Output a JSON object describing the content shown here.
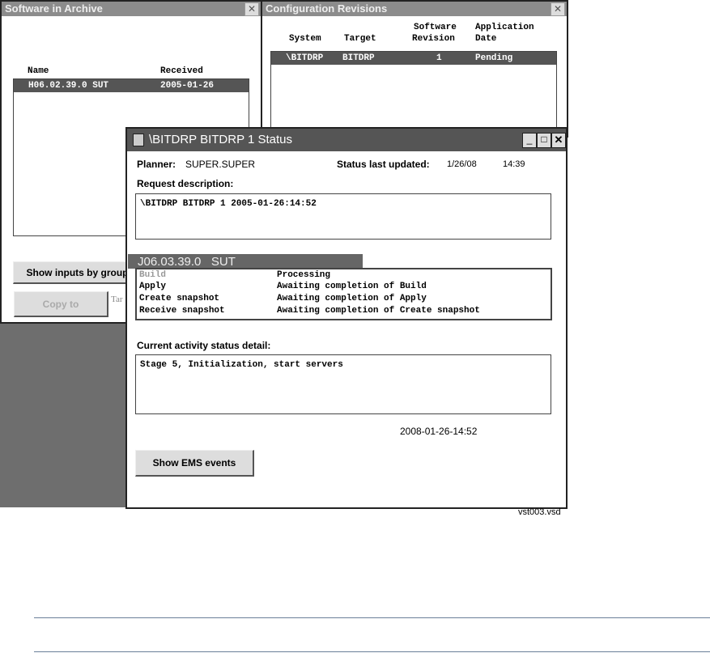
{
  "archive": {
    "title": "Software in Archive",
    "close": "✕",
    "col_name": "Name",
    "col_received": "Received",
    "rows": [
      {
        "name": "H06.02.39.0 SUT",
        "received": "2005-01-26"
      }
    ],
    "show_inputs_btn": "Show inputs by group",
    "copy_btn": "Copy to",
    "target_frag": "Tar"
  },
  "config": {
    "title": "Configuration Revisions",
    "close": "✕",
    "col_system": "System",
    "col_target": "Target",
    "col_rev1": "Software",
    "col_rev2": "Revision",
    "col_app1": "Application",
    "col_app2": "Date",
    "rows": [
      {
        "system": "\\BITDRP",
        "target": "BITDRP",
        "revision": "1",
        "date": "Pending"
      }
    ]
  },
  "status": {
    "title": "\\BITDRP BITDRP 1 Status",
    "planner_label": "Planner:",
    "planner": "SUPER.SUPER",
    "updated_label": "Status last updated:",
    "updated_date": "1/26/08",
    "updated_time": "14:39",
    "request_label": "Request description:",
    "request": "\\BITDRP BITDRP 1 2005-01-26:14:52",
    "group": "J06.03.39.0   SUT",
    "steps": [
      {
        "step": "Build",
        "state": "Processing"
      },
      {
        "step": "Apply",
        "state": "Awaiting completion of Build"
      },
      {
        "step": "Create snapshot",
        "state": "Awaiting completion of Apply"
      },
      {
        "step": "Receive snapshot",
        "state": "Awaiting completion of Create snapshot"
      }
    ],
    "activity_label": "Current activity status detail:",
    "activity": "Stage 5, Initialization, start servers",
    "timestamp": "2008-01-26-14:52",
    "ems_btn": "Show EMS events",
    "min": "_",
    "max": "□",
    "close": "✕"
  },
  "caption": "vst003.vsd"
}
